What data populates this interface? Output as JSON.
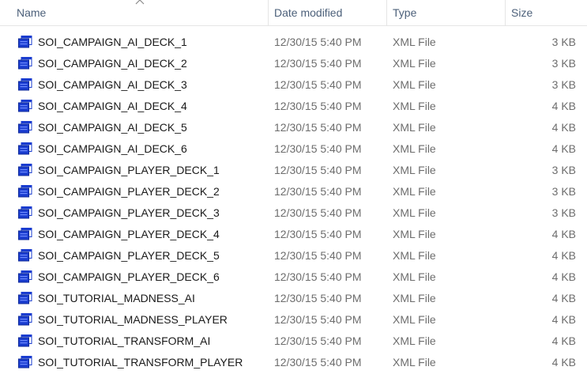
{
  "columns": {
    "name": "Name",
    "date_modified": "Date modified",
    "type": "Type",
    "size": "Size",
    "sort_icon": "chevron-up-icon"
  },
  "file_icon": "xml-file-icon",
  "colors": {
    "header_text": "#4c607a",
    "icon_blue": "#1a3ccf",
    "secondary_text": "#6d6d6d"
  },
  "files": [
    {
      "name": "SOI_CAMPAIGN_AI_DECK_1",
      "date": "12/30/15 5:40 PM",
      "type": "XML File",
      "size": "3 KB"
    },
    {
      "name": "SOI_CAMPAIGN_AI_DECK_2",
      "date": "12/30/15 5:40 PM",
      "type": "XML File",
      "size": "3 KB"
    },
    {
      "name": "SOI_CAMPAIGN_AI_DECK_3",
      "date": "12/30/15 5:40 PM",
      "type": "XML File",
      "size": "3 KB"
    },
    {
      "name": "SOI_CAMPAIGN_AI_DECK_4",
      "date": "12/30/15 5:40 PM",
      "type": "XML File",
      "size": "4 KB"
    },
    {
      "name": "SOI_CAMPAIGN_AI_DECK_5",
      "date": "12/30/15 5:40 PM",
      "type": "XML File",
      "size": "4 KB"
    },
    {
      "name": "SOI_CAMPAIGN_AI_DECK_6",
      "date": "12/30/15 5:40 PM",
      "type": "XML File",
      "size": "4 KB"
    },
    {
      "name": "SOI_CAMPAIGN_PLAYER_DECK_1",
      "date": "12/30/15 5:40 PM",
      "type": "XML File",
      "size": "3 KB"
    },
    {
      "name": "SOI_CAMPAIGN_PLAYER_DECK_2",
      "date": "12/30/15 5:40 PM",
      "type": "XML File",
      "size": "3 KB"
    },
    {
      "name": "SOI_CAMPAIGN_PLAYER_DECK_3",
      "date": "12/30/15 5:40 PM",
      "type": "XML File",
      "size": "3 KB"
    },
    {
      "name": "SOI_CAMPAIGN_PLAYER_DECK_4",
      "date": "12/30/15 5:40 PM",
      "type": "XML File",
      "size": "4 KB"
    },
    {
      "name": "SOI_CAMPAIGN_PLAYER_DECK_5",
      "date": "12/30/15 5:40 PM",
      "type": "XML File",
      "size": "4 KB"
    },
    {
      "name": "SOI_CAMPAIGN_PLAYER_DECK_6",
      "date": "12/30/15 5:40 PM",
      "type": "XML File",
      "size": "4 KB"
    },
    {
      "name": "SOI_TUTORIAL_MADNESS_AI",
      "date": "12/30/15 5:40 PM",
      "type": "XML File",
      "size": "4 KB"
    },
    {
      "name": "SOI_TUTORIAL_MADNESS_PLAYER",
      "date": "12/30/15 5:40 PM",
      "type": "XML File",
      "size": "4 KB"
    },
    {
      "name": "SOI_TUTORIAL_TRANSFORM_AI",
      "date": "12/30/15 5:40 PM",
      "type": "XML File",
      "size": "4 KB"
    },
    {
      "name": "SOI_TUTORIAL_TRANSFORM_PLAYER",
      "date": "12/30/15 5:40 PM",
      "type": "XML File",
      "size": "4 KB"
    }
  ]
}
